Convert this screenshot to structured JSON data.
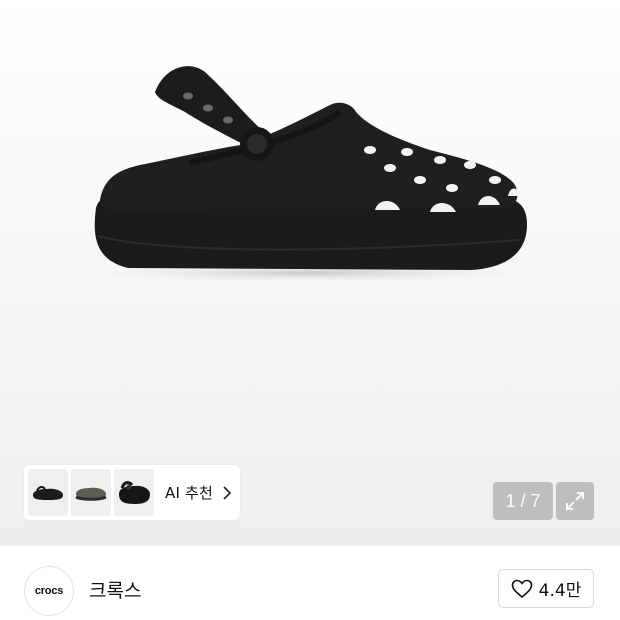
{
  "gallery": {
    "current_page": "1",
    "total_pages": "7",
    "counter_text": "1 / 7",
    "ai_recommend": {
      "label": "AI 추천",
      "thumbnails": [
        "black-clog-thumbnail",
        "olive-clog-thumbnail",
        "black-platform-clog-thumbnail"
      ]
    },
    "expand_icon": "expand-icon"
  },
  "brand": {
    "logo_text": "crocs",
    "name": "크록스"
  },
  "like": {
    "icon": "heart-outline-icon",
    "count": "4.4만"
  },
  "colors": {
    "overlay_button": "#9a9a9a",
    "border": "#d9d9d9",
    "text": "#111111"
  }
}
